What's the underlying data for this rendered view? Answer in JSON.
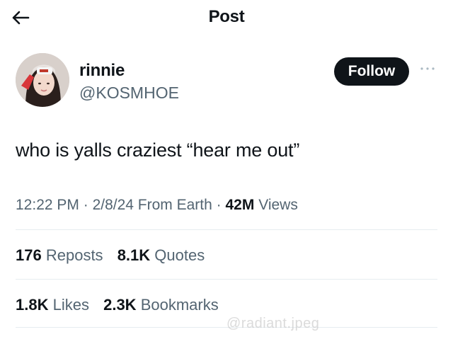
{
  "header": {
    "title": "Post",
    "back_icon": "arrow-left-icon"
  },
  "author": {
    "display_name": "rinnie",
    "handle": "@KOSMHOE",
    "follow_label": "Follow",
    "more_icon": "more-horizontal-icon"
  },
  "tweet": {
    "text": "who is yalls craziest “hear me out”"
  },
  "meta": {
    "time": "12:22 PM",
    "date": "2/8/24",
    "source": "From Earth",
    "views_count": "42M",
    "views_label": "Views"
  },
  "stats": {
    "reposts_count": "176",
    "reposts_label": "Reposts",
    "quotes_count": "8.1K",
    "quotes_label": "Quotes",
    "likes_count": "1.8K",
    "likes_label": "Likes",
    "bookmarks_count": "2.3K",
    "bookmarks_label": "Bookmarks"
  },
  "watermark": "@radiant.jpeg",
  "colors": {
    "text_primary": "#0f1419",
    "text_secondary": "#536471",
    "button_bg": "#0f1419",
    "divider": "#e6ecf0"
  }
}
